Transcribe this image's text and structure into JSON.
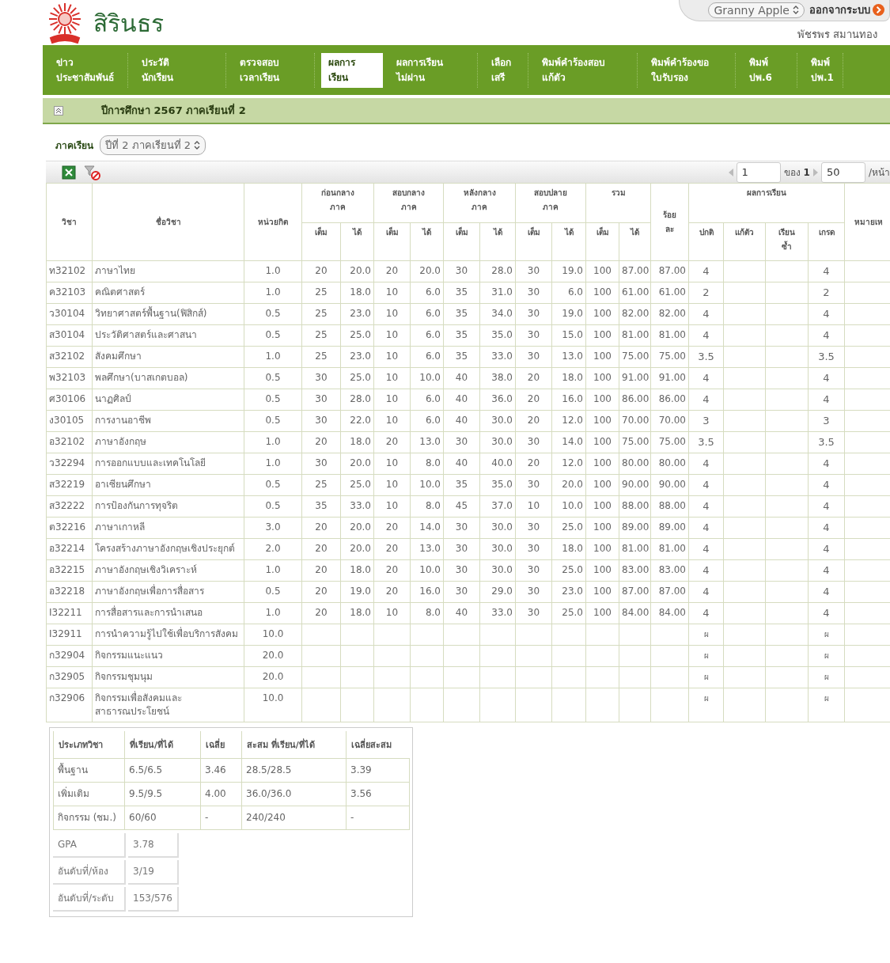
{
  "logo": {
    "text": "สิรินธร"
  },
  "user_bar": {
    "theme_select": "Granny Apple",
    "logout": "ออกจากระบบ",
    "user_name": "พัชรพร สมานทอง"
  },
  "nav": [
    {
      "lines": [
        "ข่าว",
        "ประชาสัมพันธ์"
      ],
      "selected": false
    },
    {
      "lines": [
        "ประวัติ",
        "นักเรียน"
      ],
      "selected": false
    },
    {
      "lines": [
        "ตรวจสอบ",
        "เวลาเรียน"
      ],
      "selected": false
    },
    {
      "lines": [
        "ผลการ",
        "เรียน"
      ],
      "selected": true
    },
    {
      "lines": [
        "ผลการเรียน",
        "ไม่ผ่าน"
      ],
      "selected": false
    },
    {
      "lines": [
        "เลือก",
        "เสรี"
      ],
      "selected": false
    },
    {
      "lines": [
        "พิมพ์คำร้องสอบ",
        "แก้ตัว"
      ],
      "selected": false
    },
    {
      "lines": [
        "พิมพ์คำร้องขอ",
        "ใบรับรอง"
      ],
      "selected": false
    },
    {
      "lines": [
        "พิมพ์",
        "ปพ.6"
      ],
      "selected": false
    },
    {
      "lines": [
        "พิมพ์",
        "ปพ.1"
      ],
      "selected": false
    }
  ],
  "section": {
    "title": "ปีการศึกษา 2567 ภาคเรียนที่ 2"
  },
  "term_filter": {
    "label": "ภาคเรียน",
    "value": "ปีที่ 2 ภาคเรียนที่ 2"
  },
  "pager": {
    "page": "1",
    "of_label": "ของ",
    "total": "1",
    "page_size": "50",
    "per_page_label": "/หน้า"
  },
  "table": {
    "headers": {
      "code": "วิชา",
      "name": "ชื่อวิชา",
      "credit": "หน่วยกิต",
      "score_groups": [
        {
          "lines": [
            "ก่อนกลาง",
            "ภาค"
          ],
          "sub": [
            "เต็ม",
            "ได้"
          ]
        },
        {
          "lines": [
            "สอบกลาง",
            "ภาค"
          ],
          "sub": [
            "เต็ม",
            "ได้"
          ]
        },
        {
          "lines": [
            "หลังกลาง",
            "ภาค"
          ],
          "sub": [
            "เต็ม",
            "ได้"
          ]
        },
        {
          "lines": [
            "สอบปลาย",
            "ภาค"
          ],
          "sub": [
            "เต็ม",
            "ได้"
          ]
        },
        {
          "lines": [
            "รวม"
          ],
          "sub": [
            "เต็ม",
            "ได้"
          ]
        }
      ],
      "percent": [
        "ร้อย",
        "ละ"
      ],
      "result": {
        "title": "ผลการเรียน",
        "sub": [
          [
            "ปกติ"
          ],
          [
            "แก้ตัว"
          ],
          [
            "เรียน",
            "ซ้ำ"
          ],
          [
            "เกรด"
          ]
        ]
      },
      "note": "หมายเห"
    },
    "rows": [
      {
        "code": "ท32102",
        "name": "ภาษาไทย",
        "credit": "1.0",
        "scores": [
          "20",
          "20.0",
          "20",
          "20.0",
          "30",
          "28.0",
          "30",
          "19.0",
          "100",
          "87.00"
        ],
        "percent": "87.00",
        "normal": "4",
        "grade": "4"
      },
      {
        "code": "ค32103",
        "name": "คณิตศาสตร์",
        "credit": "1.0",
        "scores": [
          "25",
          "18.0",
          "10",
          "6.0",
          "35",
          "31.0",
          "30",
          "6.0",
          "100",
          "61.00"
        ],
        "percent": "61.00",
        "normal": "2",
        "grade": "2"
      },
      {
        "code": "ว30104",
        "name": "วิทยาศาสตร์พื้นฐาน(ฟิสิกส์)",
        "credit": "0.5",
        "scores": [
          "25",
          "23.0",
          "10",
          "6.0",
          "35",
          "34.0",
          "30",
          "19.0",
          "100",
          "82.00"
        ],
        "percent": "82.00",
        "normal": "4",
        "grade": "4"
      },
      {
        "code": "ส30104",
        "name": "ประวัติศาสตร์และศาสนา",
        "credit": "0.5",
        "scores": [
          "25",
          "25.0",
          "10",
          "6.0",
          "35",
          "35.0",
          "30",
          "15.0",
          "100",
          "81.00"
        ],
        "percent": "81.00",
        "normal": "4",
        "grade": "4"
      },
      {
        "code": "ส32102",
        "name": "สังคมศึกษา",
        "credit": "1.0",
        "scores": [
          "25",
          "23.0",
          "10",
          "6.0",
          "35",
          "33.0",
          "30",
          "13.0",
          "100",
          "75.00"
        ],
        "percent": "75.00",
        "normal": "3.5",
        "grade": "3.5"
      },
      {
        "code": "พ32103",
        "name": "พลศึกษา(บาสเกตบอล)",
        "credit": "0.5",
        "scores": [
          "30",
          "25.0",
          "10",
          "10.0",
          "40",
          "38.0",
          "20",
          "18.0",
          "100",
          "91.00"
        ],
        "percent": "91.00",
        "normal": "4",
        "grade": "4"
      },
      {
        "code": "ศ30106",
        "name": "นาฏศิลป์",
        "credit": "0.5",
        "scores": [
          "30",
          "28.0",
          "10",
          "6.0",
          "40",
          "36.0",
          "20",
          "16.0",
          "100",
          "86.00"
        ],
        "percent": "86.00",
        "normal": "4",
        "grade": "4"
      },
      {
        "code": "ง30105",
        "name": "การงานอาชีพ",
        "credit": "0.5",
        "scores": [
          "30",
          "22.0",
          "10",
          "6.0",
          "40",
          "30.0",
          "20",
          "12.0",
          "100",
          "70.00"
        ],
        "percent": "70.00",
        "normal": "3",
        "grade": "3"
      },
      {
        "code": "อ32102",
        "name": "ภาษาอังกฤษ",
        "credit": "1.0",
        "scores": [
          "20",
          "18.0",
          "20",
          "13.0",
          "30",
          "30.0",
          "30",
          "14.0",
          "100",
          "75.00"
        ],
        "percent": "75.00",
        "normal": "3.5",
        "grade": "3.5"
      },
      {
        "code": "ว32294",
        "name": "การออกแบบและเทคโนโลยี",
        "credit": "1.0",
        "scores": [
          "30",
          "20.0",
          "10",
          "8.0",
          "40",
          "40.0",
          "20",
          "12.0",
          "100",
          "80.00"
        ],
        "percent": "80.00",
        "normal": "4",
        "grade": "4"
      },
      {
        "code": "ส32219",
        "name": "อาเซียนศึกษา",
        "credit": "0.5",
        "scores": [
          "25",
          "25.0",
          "10",
          "10.0",
          "35",
          "35.0",
          "30",
          "20.0",
          "100",
          "90.00"
        ],
        "percent": "90.00",
        "normal": "4",
        "grade": "4"
      },
      {
        "code": "ส32222",
        "name": "การป้องกันการทุจริต",
        "credit": "0.5",
        "scores": [
          "35",
          "33.0",
          "10",
          "8.0",
          "45",
          "37.0",
          "10",
          "10.0",
          "100",
          "88.00"
        ],
        "percent": "88.00",
        "normal": "4",
        "grade": "4"
      },
      {
        "code": "ต32216",
        "name": "ภาษาเกาหลี",
        "credit": "3.0",
        "scores": [
          "20",
          "20.0",
          "20",
          "14.0",
          "30",
          "30.0",
          "30",
          "25.0",
          "100",
          "89.00"
        ],
        "percent": "89.00",
        "normal": "4",
        "grade": "4"
      },
      {
        "code": "อ32214",
        "name": "โครงสร้างภาษาอังกฤษเชิงประยุกต์",
        "credit": "2.0",
        "scores": [
          "20",
          "20.0",
          "20",
          "13.0",
          "30",
          "30.0",
          "30",
          "18.0",
          "100",
          "81.00"
        ],
        "percent": "81.00",
        "normal": "4",
        "grade": "4"
      },
      {
        "code": "อ32215",
        "name": "ภาษาอังกฤษเชิงวิเคราะห์",
        "credit": "1.0",
        "scores": [
          "20",
          "18.0",
          "20",
          "10.0",
          "30",
          "30.0",
          "30",
          "25.0",
          "100",
          "83.00"
        ],
        "percent": "83.00",
        "normal": "4",
        "grade": "4"
      },
      {
        "code": "อ32218",
        "name": "ภาษาอังกฤษเพื่อการสื่อสาร",
        "credit": "0.5",
        "scores": [
          "20",
          "19.0",
          "20",
          "16.0",
          "30",
          "29.0",
          "30",
          "23.0",
          "100",
          "87.00"
        ],
        "percent": "87.00",
        "normal": "4",
        "grade": "4"
      },
      {
        "code": "I32211",
        "name": "การสื่อสารและการนำเสนอ",
        "credit": "1.0",
        "scores": [
          "20",
          "18.0",
          "10",
          "8.0",
          "40",
          "33.0",
          "30",
          "25.0",
          "100",
          "84.00"
        ],
        "percent": "84.00",
        "normal": "4",
        "grade": "4"
      },
      {
        "code": "I32911",
        "name": "การนำความรู้ไปใช้เพื่อบริการสังคม",
        "credit": "10.0",
        "normal": "ผ",
        "grade": "ผ"
      },
      {
        "code": "ก32904",
        "name": "กิจกรรมแนะแนว",
        "credit": "20.0",
        "normal": "ผ",
        "grade": "ผ"
      },
      {
        "code": "ก32905",
        "name": "กิจกรรมชุมนุม",
        "credit": "20.0",
        "normal": "ผ",
        "grade": "ผ"
      },
      {
        "code": "ก32906",
        "name": "กิจกรรมเพื่อสังคมและสาธารณประโยชน์",
        "credit": "10.0",
        "normal": "ผ",
        "grade": "ผ"
      }
    ]
  },
  "summary": {
    "columns": [
      "ประเภทวิชา",
      "ที่เรียน/ที่ได้",
      "เฉลี่ย",
      "สะสม ที่เรียน/ที่ได้",
      "เฉลี่ยสะสม"
    ],
    "rows": [
      [
        "พื้นฐาน",
        "6.5/6.5",
        "3.46",
        "28.5/28.5",
        "3.39"
      ],
      [
        "เพิ่มเติม",
        "9.5/9.5",
        "4.00",
        "36.0/36.0",
        "3.56"
      ],
      [
        "กิจกรรม (ชม.)",
        "60/60",
        "-",
        "240/240",
        "-"
      ]
    ],
    "stats": [
      {
        "label": "GPA",
        "value": "3.78"
      },
      {
        "label": "อันดับที่/ห้อง",
        "value": "3/19"
      },
      {
        "label": "อันดับที่/ระดับ",
        "value": "153/576"
      }
    ]
  }
}
